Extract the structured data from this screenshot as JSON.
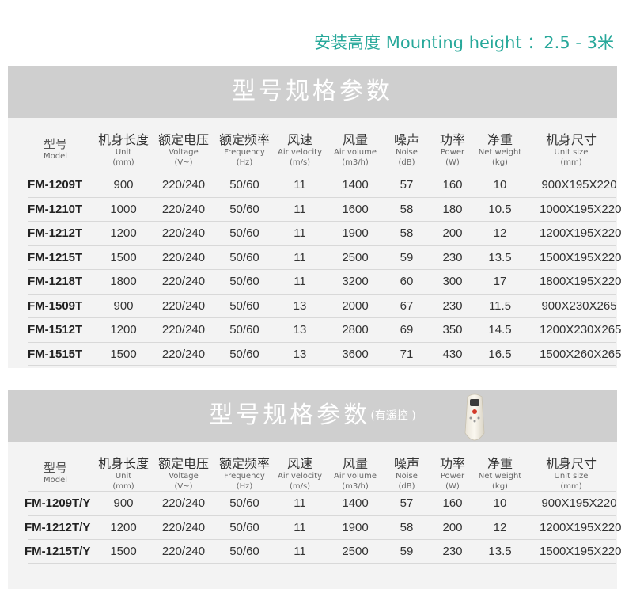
{
  "mounting_height": "安装高度 Mounting height ：2.5 - 3米",
  "headers": [
    {
      "cn": "型号",
      "en": [
        "Model"
      ]
    },
    {
      "cn": "机身长度",
      "en": [
        "Unit",
        "(mm)"
      ]
    },
    {
      "cn": "额定电压",
      "en": [
        "Voltage",
        "(V~)"
      ]
    },
    {
      "cn": "额定频率",
      "en": [
        "Frequency",
        "(Hz)"
      ]
    },
    {
      "cn": "风速",
      "en": [
        "Air velocity",
        "(m/s)"
      ]
    },
    {
      "cn": "风量",
      "en": [
        "Air volume",
        "(m3/h)"
      ]
    },
    {
      "cn": "噪声",
      "en": [
        "Noise",
        "(dB)"
      ]
    },
    {
      "cn": "功率",
      "en": [
        "Power",
        "(W)"
      ]
    },
    {
      "cn": "净重",
      "en": [
        "Net weight",
        "(kg)"
      ]
    },
    {
      "cn": "机身尺寸",
      "en": [
        "Unit size",
        "(mm)"
      ]
    }
  ],
  "table1": {
    "title": "型号规格参数",
    "rows": [
      [
        "FM-1209T",
        "900",
        "220/240",
        "50/60",
        "11",
        "1400",
        "57",
        "160",
        "10",
        "900X195X220"
      ],
      [
        "FM-1210T",
        "1000",
        "220/240",
        "50/60",
        "11",
        "1600",
        "58",
        "180",
        "10.5",
        "1000X195X220"
      ],
      [
        "FM-1212T",
        "1200",
        "220/240",
        "50/60",
        "11",
        "1900",
        "58",
        "200",
        "12",
        "1200X195X220"
      ],
      [
        "FM-1215T",
        "1500",
        "220/240",
        "50/60",
        "11",
        "2500",
        "59",
        "230",
        "13.5",
        "1500X195X220"
      ],
      [
        "FM-1218T",
        "1800",
        "220/240",
        "50/60",
        "11",
        "3200",
        "60",
        "300",
        "17",
        "1800X195X220"
      ],
      [
        "FM-1509T",
        "900",
        "220/240",
        "50/60",
        "13",
        "2000",
        "67",
        "230",
        "11.5",
        "900X230X265"
      ],
      [
        "FM-1512T",
        "1200",
        "220/240",
        "50/60",
        "13",
        "2800",
        "69",
        "350",
        "14.5",
        "1200X230X265"
      ],
      [
        "FM-1515T",
        "1500",
        "220/240",
        "50/60",
        "13",
        "3600",
        "71",
        "430",
        "16.5",
        "1500X260X265"
      ]
    ]
  },
  "table2": {
    "title": "型号规格参数",
    "subtitle": "(有遥控 )",
    "rows": [
      [
        "FM-1209T/Y",
        "900",
        "220/240",
        "50/60",
        "11",
        "1400",
        "57",
        "160",
        "10",
        "900X195X220"
      ],
      [
        "FM-1212T/Y",
        "1200",
        "220/240",
        "50/60",
        "11",
        "1900",
        "58",
        "200",
        "12",
        "1200X195X220"
      ],
      [
        "FM-1215T/Y",
        "1500",
        "220/240",
        "50/60",
        "11",
        "2500",
        "59",
        "230",
        "13.5",
        "1500X195X220"
      ]
    ]
  }
}
